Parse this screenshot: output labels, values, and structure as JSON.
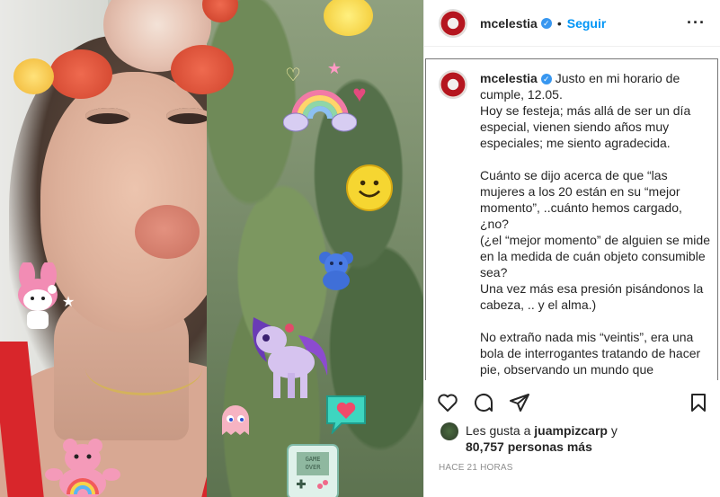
{
  "post": {
    "username": "mcelestia",
    "verified_icon": "verified-badge-icon",
    "separator": "•",
    "follow_label": "Seguir",
    "more_label": "···"
  },
  "caption": {
    "username": "mcelestia",
    "paragraphs": [
      "Justo en mi horario de cumple, 12.05.",
      "Hoy se festeja; más allá de ser un día especial, vienen siendo años muy especiales; me siento agradecida.",
      "",
      "Cuánto se dijo acerca de que “las mujeres a los 20 están en su “mejor momento”, ..cuánto hemos cargado, ¿no?",
      "(¿el “mejor momento” de alguien se mide en la medida de cuán objeto consumible sea?",
      "Una vez más esa presión pisándonos la cabeza, .. y el alma.)",
      "",
      "No extraño nada mis “veintis”, era una bola de interrogantes tratando de hacer pie, observando un mundo que"
    ]
  },
  "likes": {
    "prefix": "Les gusta a",
    "user": "juampizcarp",
    "conj": "y",
    "count": "80,757 personas más"
  },
  "timestamp": "HACE 21 HORAS",
  "icons": {
    "like": "heart-outline-icon",
    "comment": "comment-bubble-icon",
    "share": "paper-plane-icon",
    "save": "bookmark-icon"
  },
  "stickers": {
    "gameboy_text": "GAME OVER"
  },
  "colors": {
    "link_blue": "#0095f6",
    "verified": "#3897f0",
    "muted": "#8e8e8e"
  }
}
